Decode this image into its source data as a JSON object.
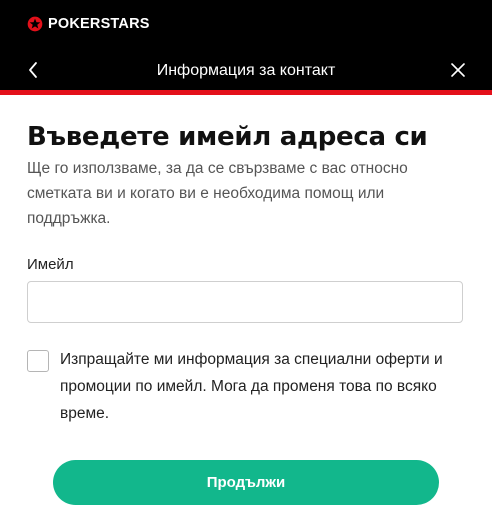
{
  "brand": {
    "name": "POKERSTARS",
    "accent_color": "#e3101a"
  },
  "header": {
    "title": "Информация за контакт",
    "back_icon": "chevron-left-icon",
    "close_icon": "close-icon"
  },
  "main": {
    "heading": "Въведете имейл адреса си",
    "subtitle": "Ще го използваме, за да се свързваме с вас относно сметката ви и когато ви е необходима помощ или поддръжка.",
    "email": {
      "label": "Имейл",
      "value": "",
      "placeholder": ""
    },
    "consent": {
      "checked": false,
      "text": "Изпращайте ми информация за специални оферти и промоции по имейл. Мога да променя това по всяко време."
    },
    "continue_label": "Продължи",
    "button_color": "#12b78c"
  }
}
